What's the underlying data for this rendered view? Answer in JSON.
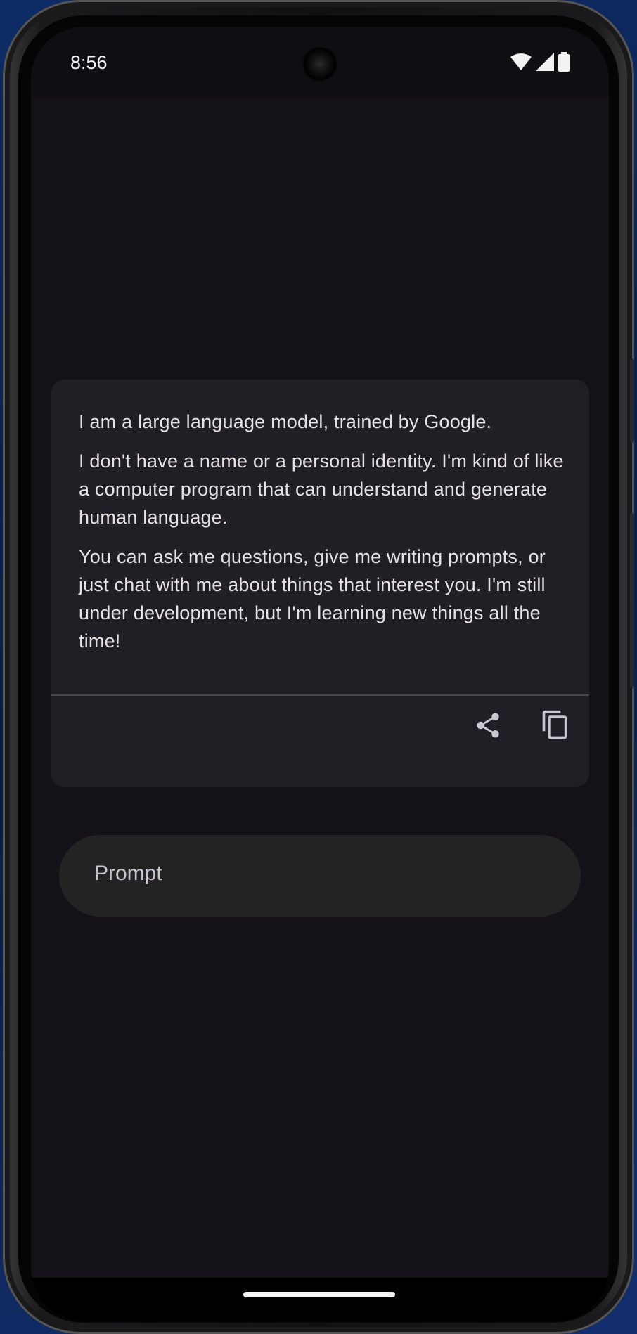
{
  "status_bar": {
    "time": "8:56",
    "icons": [
      "wifi-icon",
      "signal-icon",
      "battery-icon"
    ]
  },
  "response_card": {
    "paragraphs": [
      "I am a large language model, trained by Google.",
      "I don't have a name or a personal identity. I'm kind of like a computer program that can understand and generate human language.",
      "You can ask me questions, give me writing prompts, or just chat with me about things that interest you. I'm still under development, but I'm learning new things all the time!"
    ],
    "actions": [
      "share-icon",
      "copy-icon"
    ]
  },
  "prompt_input": {
    "placeholder": "Prompt"
  },
  "colors": {
    "background": "#141218",
    "card": "#211f26",
    "input": "#232323",
    "text": "#e6e1e5",
    "divider": "#49454f"
  }
}
